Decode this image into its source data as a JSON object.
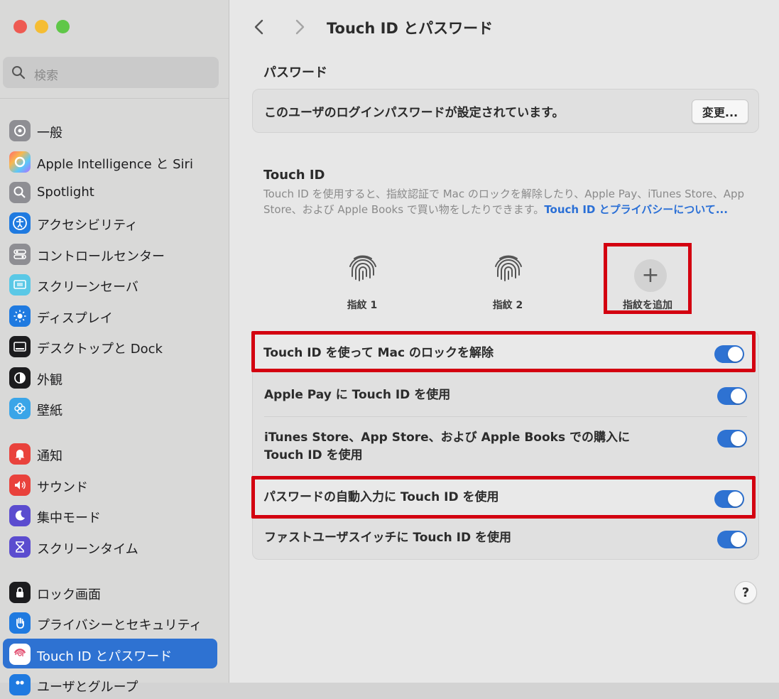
{
  "window": {
    "title": "Touch ID とパスワード"
  },
  "search": {
    "placeholder": "検索"
  },
  "sidebar": {
    "items": [
      {
        "label": "一般",
        "icon": "gear-icon"
      },
      {
        "label": "Apple Intelligence と Siri",
        "icon": "siri-icon"
      },
      {
        "label": "Spotlight",
        "icon": "spotlight-icon"
      },
      {
        "label": "アクセシビリティ",
        "icon": "accessibility-icon"
      },
      {
        "label": "コントロールセンター",
        "icon": "control-center-icon"
      },
      {
        "label": "スクリーンセーバ",
        "icon": "screensaver-icon"
      },
      {
        "label": "ディスプレイ",
        "icon": "display-icon"
      },
      {
        "label": "デスクトップと Dock",
        "icon": "dock-icon"
      },
      {
        "label": "外観",
        "icon": "appearance-icon"
      },
      {
        "label": "壁紙",
        "icon": "wallpaper-icon"
      },
      {
        "label": "通知",
        "icon": "bell-icon"
      },
      {
        "label": "サウンド",
        "icon": "speaker-icon"
      },
      {
        "label": "集中モード",
        "icon": "moon-icon"
      },
      {
        "label": "スクリーンタイム",
        "icon": "hourglass-icon"
      },
      {
        "label": "ロック画面",
        "icon": "lock-icon"
      },
      {
        "label": "プライバシーとセキュリティ",
        "icon": "hand-icon"
      },
      {
        "label": "Touch ID とパスワード",
        "icon": "fingerprint-icon",
        "selected": true
      },
      {
        "label": "ユーザとグループ",
        "icon": "users-icon"
      }
    ]
  },
  "password": {
    "section_title": "パスワード",
    "status_text": "このユーザのログインパスワードが設定されています。",
    "change_label": "変更..."
  },
  "touchid": {
    "section_title": "Touch ID",
    "description": "Touch ID を使用すると、指紋認証で Mac のロックを解除したり、Apple Pay、iTunes Store、App Store、および Apple Books で買い物をしたりできます。",
    "link_text": "Touch ID とプライバシーについて...",
    "fingerprints": [
      {
        "label": "指紋 1"
      },
      {
        "label": "指紋 2"
      }
    ],
    "add_label": "指紋を追加",
    "options": [
      {
        "label": "Touch ID を使って Mac のロックを解除",
        "enabled": true
      },
      {
        "label": "Apple Pay に Touch ID を使用",
        "enabled": true
      },
      {
        "label_line1": "iTunes Store、App Store、および Apple Books での購入に",
        "label_line2": "Touch ID を使用",
        "enabled": true
      },
      {
        "label": "パスワードの自動入力に Touch ID を使用",
        "enabled": true
      },
      {
        "label": "ファストユーザスイッチに Touch ID を使用",
        "enabled": true
      }
    ]
  },
  "help": {
    "label": "?"
  },
  "colors": {
    "accent": "#2e72d2",
    "highlight": "#d30010",
    "link": "#2a6fd6"
  }
}
